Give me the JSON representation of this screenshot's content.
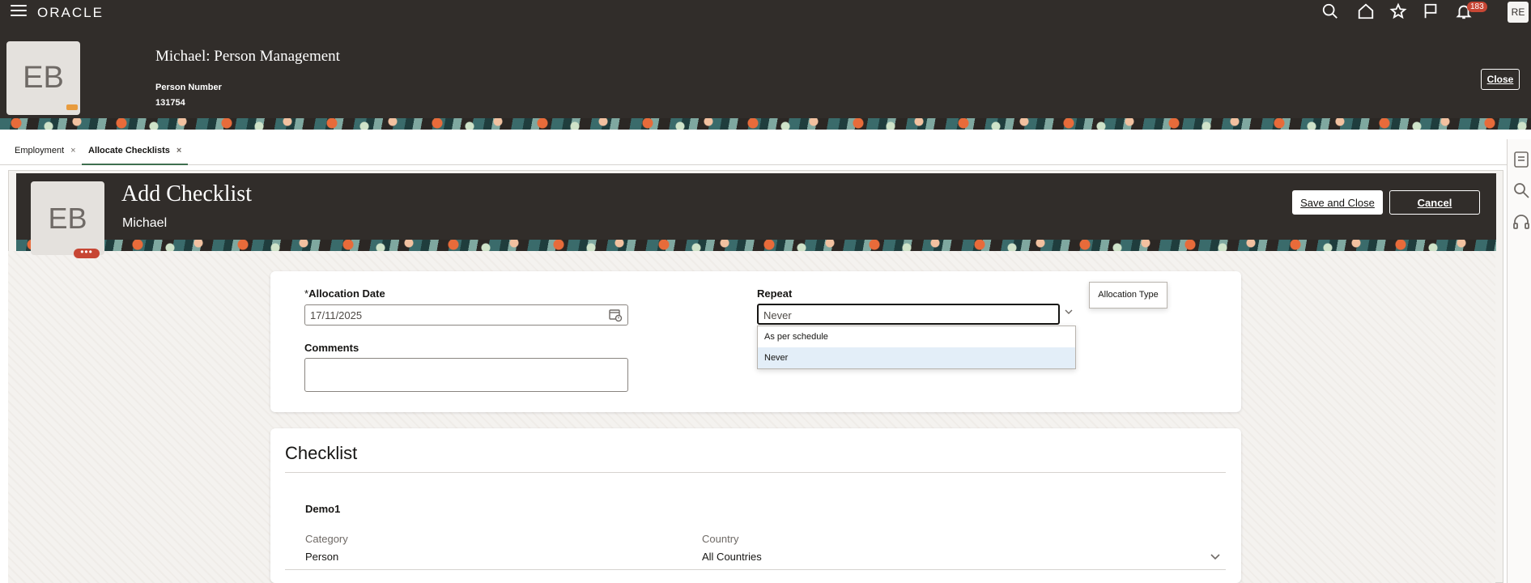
{
  "app": {
    "logo": "ORACLE",
    "notifications_count": "183",
    "user_initials": "RE"
  },
  "person": {
    "avatar_initials": "EB",
    "title": "Michael: Person Management",
    "number_label": "Person Number",
    "number_value": "131754",
    "close_label": "Close"
  },
  "tabs": [
    {
      "label": "Employment",
      "close": "×"
    },
    {
      "label": "Allocate Checklists",
      "close": "×"
    }
  ],
  "page": {
    "avatar_initials": "EB",
    "more_label": "•••",
    "title": "Add Checklist",
    "subtitle": "Michael",
    "save_label": "Save and Close",
    "cancel_label": "Cancel"
  },
  "form": {
    "allocation_date": {
      "required_mark": "*",
      "label": "Allocation Date",
      "value": "17/11/2025"
    },
    "comments": {
      "label": "Comments",
      "value": ""
    },
    "repeat": {
      "label": "Repeat",
      "value": "Never",
      "tooltip": "Allocation Type",
      "options": [
        "As per schedule",
        "Never"
      ],
      "selected": "Never"
    }
  },
  "checklist": {
    "section_title": "Checklist",
    "item": {
      "name": "Demo1",
      "category_label": "Category",
      "category_value": "Person",
      "country_label": "Country",
      "country_value": "All Countries"
    }
  },
  "colors": {
    "header_bg": "#312d2a",
    "accent_red": "#c74634",
    "tab_underline": "#3f6f4f",
    "selected_option_bg": "#e3eef8"
  }
}
